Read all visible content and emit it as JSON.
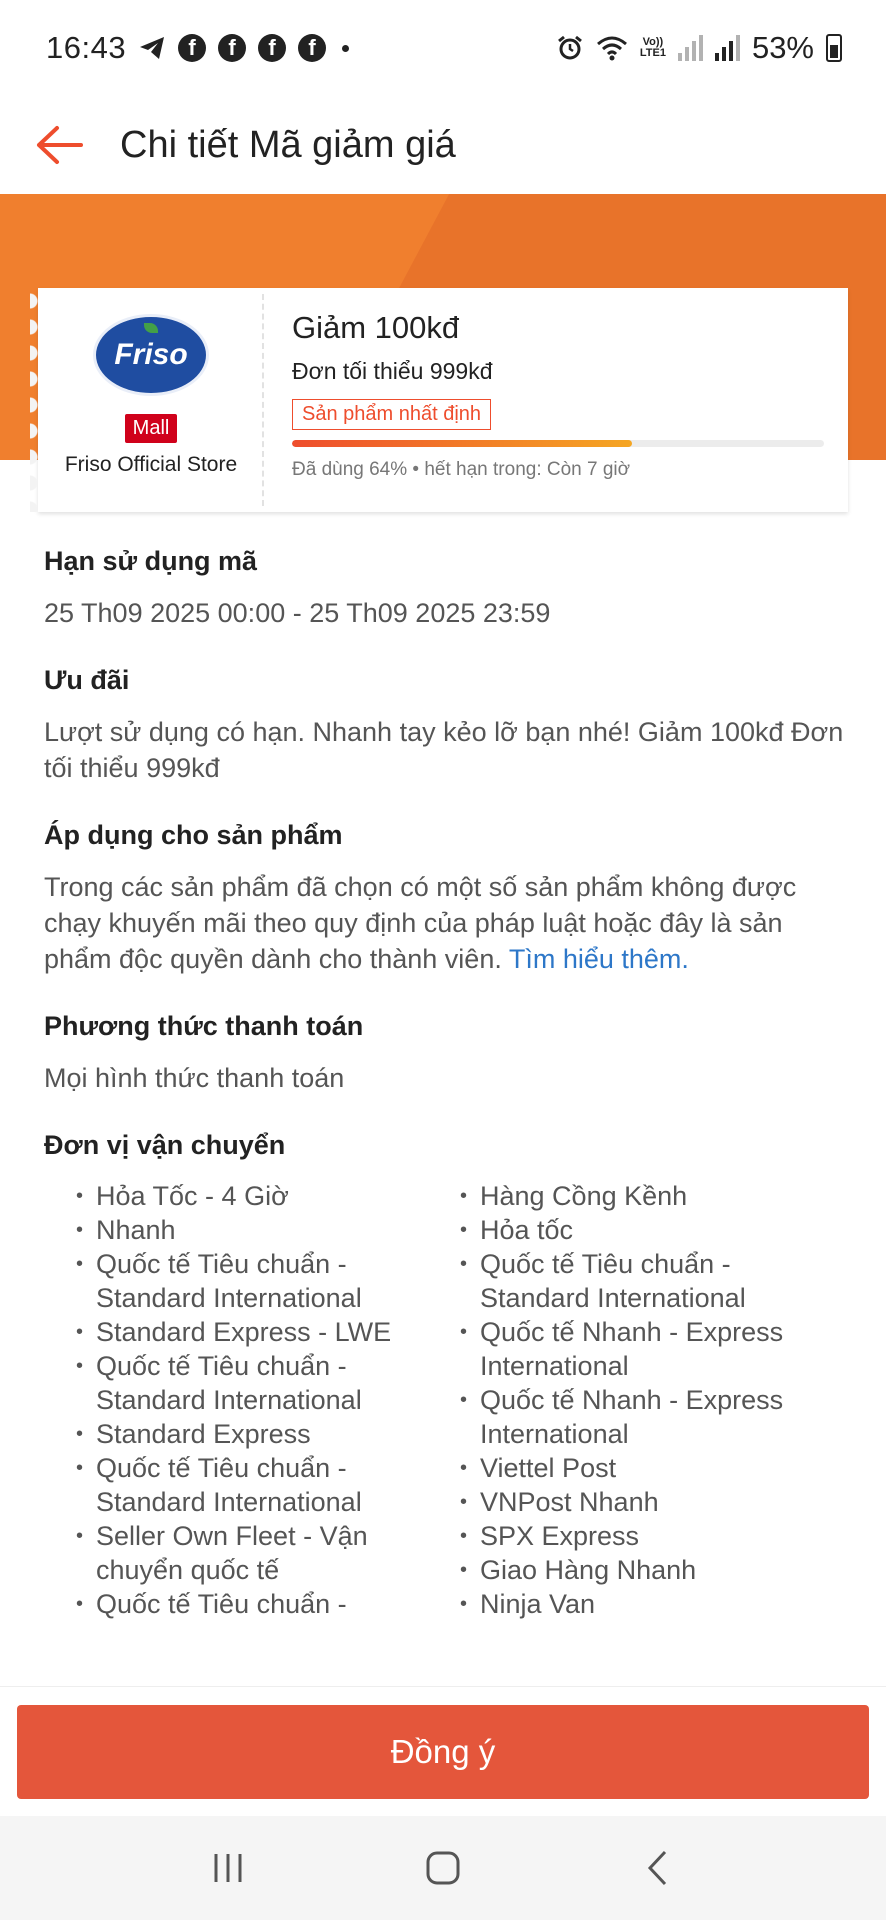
{
  "status_bar": {
    "time": "16:43",
    "volte_top": "Vo))",
    "volte_bottom": "LTE1",
    "battery": "53%"
  },
  "header": {
    "title": "Chi tiết Mã giảm giá"
  },
  "voucher": {
    "logo_text": "Friso",
    "mall_badge": "Mall",
    "store_name": "Friso Official Store",
    "title": "Giảm 100kđ",
    "min_order": "Đơn tối thiểu 999kđ",
    "tag": "Sản phẩm nhất định",
    "used_fraction": 0.64,
    "usage_text": "Đã dùng 64% • hết hạn trong: Còn 7 giờ"
  },
  "sections": {
    "validity": {
      "heading": "Hạn sử dụng mã",
      "text": "25 Th09 2025 00:00 - 25 Th09 2025 23:59"
    },
    "offer": {
      "heading": "Ưu đãi",
      "text": "Lượt sử dụng có hạn. Nhanh tay kẻo lỡ bạn nhé! Giảm 100kđ Đơn tối thiểu 999kđ"
    },
    "products": {
      "heading": "Áp dụng cho sản phẩm",
      "text": "Trong các sản phẩm đã chọn có một số sản phẩm không được chạy khuyến mãi theo quy định của pháp luật hoặc đây là sản phẩm độc quyền dành cho thành viên. ",
      "link": "Tìm hiểu thêm."
    },
    "payment": {
      "heading": "Phương thức thanh toán",
      "text": "Mọi hình thức thanh toán"
    },
    "shipping": {
      "heading": "Đơn vị vận chuyển",
      "left": [
        "Hỏa Tốc - 4 Giờ",
        "Nhanh",
        "Quốc tế Tiêu chuẩn - Standard International",
        "Standard Express - LWE",
        "Quốc tế Tiêu chuẩn - Standard International",
        "Standard Express",
        "Quốc tế Tiêu chuẩn - Standard International",
        "Seller Own Fleet - Vận chuyển quốc tế",
        "Quốc tế Tiêu chuẩn -"
      ],
      "right": [
        "Hàng Cồng Kềnh",
        "Hỏa tốc",
        "Quốc tế Tiêu chuẩn - Standard International",
        "Quốc tế Nhanh - Express International",
        "Quốc tế Nhanh - Express International",
        "Viettel Post",
        "VNPost Nhanh",
        "SPX Express",
        "Giao Hàng Nhanh",
        "Ninja Van"
      ]
    }
  },
  "footer": {
    "agree_label": "Đồng ý"
  },
  "colors": {
    "accent": "#ee4d2d",
    "button": "#e4563b",
    "banner": "#f07f2e",
    "link": "#2d77c8"
  }
}
